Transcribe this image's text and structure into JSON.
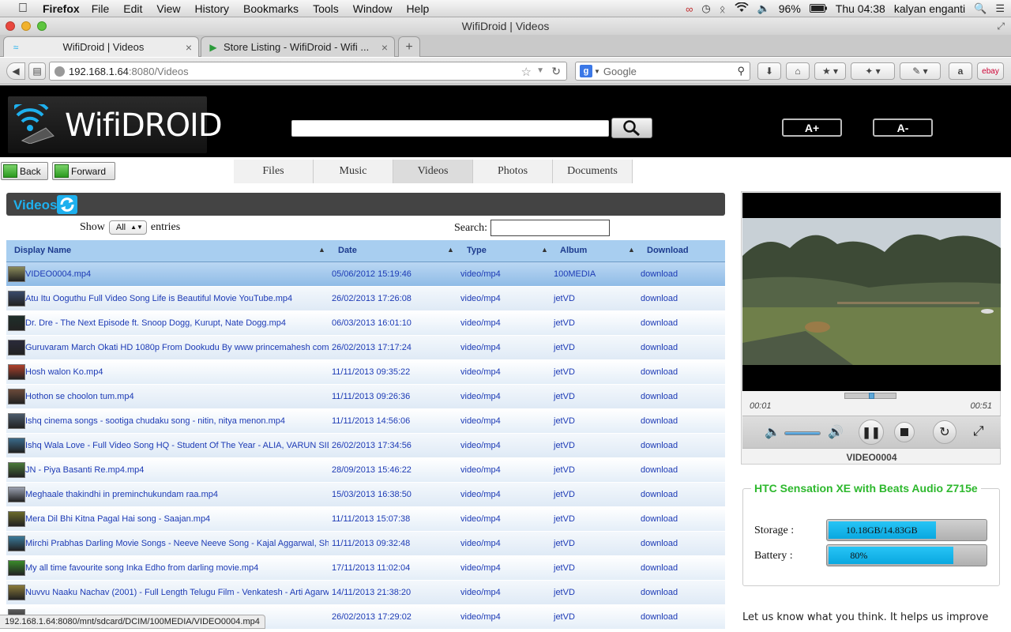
{
  "menubar": {
    "app_name": "Firefox",
    "items": [
      "File",
      "Edit",
      "View",
      "History",
      "Bookmarks",
      "Tools",
      "Window",
      "Help"
    ],
    "battery": "96%",
    "clock": "Thu 04:38",
    "user": "kalyan enganti"
  },
  "window": {
    "title": "WifiDroid | Videos"
  },
  "tabs": [
    {
      "title": "WifiDroid | Videos",
      "active": true
    },
    {
      "title": "Store Listing - WifiDroid - Wifi ...",
      "active": false
    }
  ],
  "navbar": {
    "url_host": "192.168.1.64",
    "url_rest": ":8080/Videos",
    "search_placeholder": "Google"
  },
  "site": {
    "logo_text": "WifiDROID",
    "font_up_label": "A+",
    "font_down_label": "A-",
    "back_label": "Back",
    "forward_label": "Forward",
    "menu": [
      "Files",
      "Music",
      "Videos",
      "Photos",
      "Documents"
    ],
    "active_menu": "Videos"
  },
  "videos_panel": {
    "title": "Videos",
    "show_label": "Show",
    "show_value": "All",
    "entries_label": "entries",
    "search_label": "Search:",
    "columns": [
      "Display Name",
      "Date",
      "Type",
      "Album",
      "Download"
    ],
    "rows": [
      {
        "name": "VIDEO0004.mp4",
        "date": "05/06/2012 15:19:46",
        "type": "video/mp4",
        "album": "100MEDIA",
        "download": "download",
        "thumb": "#8a8a5a"
      },
      {
        "name": "Atu Itu Ooguthu Full Video Song Life is Beautiful Movie YouTube.mp4",
        "date": "26/02/2013 17:26:08",
        "type": "video/mp4",
        "album": "jetVD",
        "download": "download",
        "thumb": "#3a4a6a"
      },
      {
        "name": "Dr. Dre - The Next Episode ft. Snoop Dogg, Kurupt, Nate Dogg.mp4",
        "date": "06/03/2013 16:01:10",
        "type": "video/mp4",
        "album": "jetVD",
        "download": "download",
        "thumb": "#1f2f2a"
      },
      {
        "name": "Guruvaram March Okati HD 1080p From Dookudu By www princemahesh com Videos.mp4",
        "date": "26/02/2013 17:17:24",
        "type": "video/mp4",
        "album": "jetVD",
        "download": "download",
        "thumb": "#2a2a3a"
      },
      {
        "name": "Hosh walon Ko.mp4",
        "date": "11/11/2013 09:35:22",
        "type": "video/mp4",
        "album": "jetVD",
        "download": "download",
        "thumb": "#b0402a"
      },
      {
        "name": "Hothon se choolon tum.mp4",
        "date": "11/11/2013 09:26:36",
        "type": "video/mp4",
        "album": "jetVD",
        "download": "download",
        "thumb": "#6a4a3a"
      },
      {
        "name": "Ishq cinema songs - sootiga chudaku song - nitin, nitya menon.mp4",
        "date": "11/11/2013 14:56:06",
        "type": "video/mp4",
        "album": "jetVD",
        "download": "download",
        "thumb": "#4a5a6a"
      },
      {
        "name": "Ishq Wala Love - Full Video Song HQ - Student Of The Year - ALIA, VARUN SIDHARTH.mp4",
        "date": "26/02/2013 17:34:56",
        "type": "video/mp4",
        "album": "jetVD",
        "download": "download",
        "thumb": "#3a6a8a"
      },
      {
        "name": "JN - Piya Basanti Re.mp4.mp4",
        "date": "28/09/2013 15:46:22",
        "type": "video/mp4",
        "album": "jetVD",
        "download": "download",
        "thumb": "#4a7a3a"
      },
      {
        "name": "Meghaale thakindhi in preminchukundam raa.mp4",
        "date": "15/03/2013 16:38:50",
        "type": "video/mp4",
        "album": "jetVD",
        "download": "download",
        "thumb": "#9aa0b0"
      },
      {
        "name": "Mera Dil Bhi Kitna Pagal Hai song - Saajan.mp4",
        "date": "11/11/2013 15:07:38",
        "type": "video/mp4",
        "album": "jetVD",
        "download": "download",
        "thumb": "#6a6a2a"
      },
      {
        "name": "Mirchi Prabhas Darling Movie Songs - Neeve Neeve Song - Kajal Aggarwal, Shraddha Das.mp4",
        "date": "11/11/2013 09:32:48",
        "type": "video/mp4",
        "album": "jetVD",
        "download": "download",
        "thumb": "#3a7a9a"
      },
      {
        "name": "My all time favourite song Inka Edho from darling movie.mp4",
        "date": "17/11/2013 11:02:04",
        "type": "video/mp4",
        "album": "jetVD",
        "download": "download",
        "thumb": "#3a8a2a"
      },
      {
        "name": "Nuvvu Naaku Nachav (2001) - Full Length Telugu Film - Venkatesh - Arti Agarwal.mp4",
        "date": "14/11/2013 21:38:20",
        "type": "video/mp4",
        "album": "jetVD",
        "download": "download",
        "thumb": "#8a7a3a"
      },
      {
        "name": "",
        "date": "26/02/2013 17:29:02",
        "type": "video/mp4",
        "album": "jetVD",
        "download": "download",
        "thumb": "#5a5a5a"
      }
    ]
  },
  "player": {
    "time_current": "00:01",
    "time_duration": "00:51",
    "progress": 0.02,
    "volume": 1.0,
    "video_name": "VIDEO0004"
  },
  "device": {
    "name": "HTC Sensation XE with Beats Audio Z715e",
    "storage_label": "Storage :",
    "storage_text": "10.18GB/14.83GB",
    "storage_fraction": 0.686,
    "battery_label": "Battery :",
    "battery_text": "80%",
    "battery_fraction": 0.8
  },
  "feedback_text": "Let us know what you think. It helps us improve",
  "status_url": "192.168.1.64:8080/mnt/sdcard/DCIM/100MEDIA/VIDEO0004.mp4",
  "colors": {
    "accent": "#1eb0ee",
    "device_title": "#2db82d",
    "link": "#1c3ab5"
  }
}
